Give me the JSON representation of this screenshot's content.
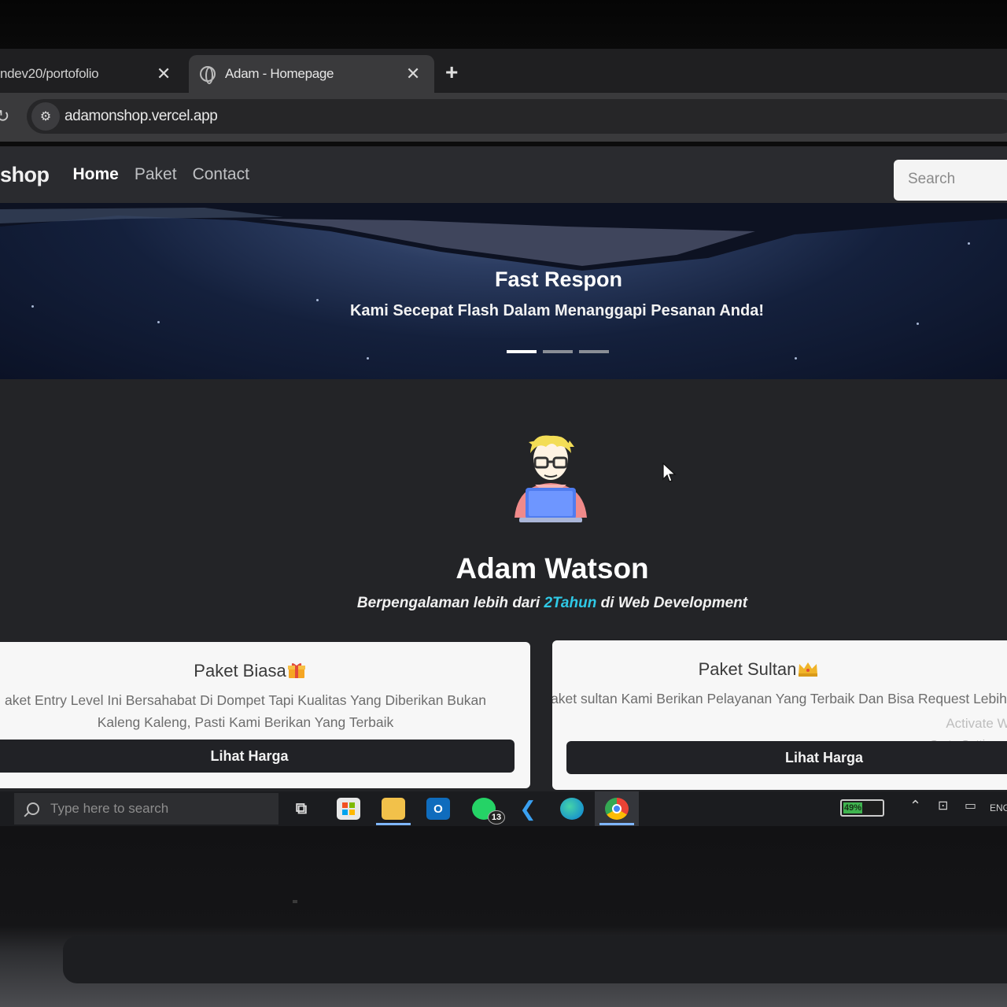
{
  "browser": {
    "tabs": [
      {
        "title": "ndev20/portofolio",
        "close": "✕"
      },
      {
        "title": "Adam - Homepage",
        "close": "✕"
      }
    ],
    "new_tab": "+",
    "url": "adamonshop.vercel.app",
    "reload_icon": "↻"
  },
  "navbar": {
    "brand": "shop",
    "links": [
      "Home",
      "Paket",
      "Contact"
    ],
    "search_placeholder": "Search"
  },
  "hero": {
    "title": "Fast Respon",
    "subtitle": "Kami Secepat Flash Dalam Menanggapi Pesanan Anda!",
    "slide_count": 3,
    "active_slide": 1
  },
  "profile": {
    "name": "Adam Watson",
    "tagline_pre": "Berpengalaman lebih dari ",
    "tagline_highlight": "2Tahun",
    "tagline_post": " di Web Development",
    "highlight_color": "#2fc9e6"
  },
  "cards": [
    {
      "title": "Paket Biasa",
      "icon": "gift-icon",
      "text": "aket Entry Level Ini Bersahabat Di Dompet Tapi Kualitas Yang Diberikan Bukan Kaleng Kaleng, Pasti Kami Berikan Yang Terbaik",
      "button": "Lihat Harga"
    },
    {
      "title": "Paket Sultan",
      "icon": "crown-icon",
      "text": "Paket sultan Kami Berikan Pelayanan Yang Terbaik Dan Bisa Request Lebih Kompleks",
      "button": "Lihat Harga"
    }
  ],
  "windows_watermark": {
    "line1": "Activate Window",
    "line2": "Go to Settings to activ"
  },
  "taskbar": {
    "search_placeholder": "Type here to search",
    "whatsapp_badge": "13",
    "battery": "49%",
    "lang": "ENG"
  }
}
